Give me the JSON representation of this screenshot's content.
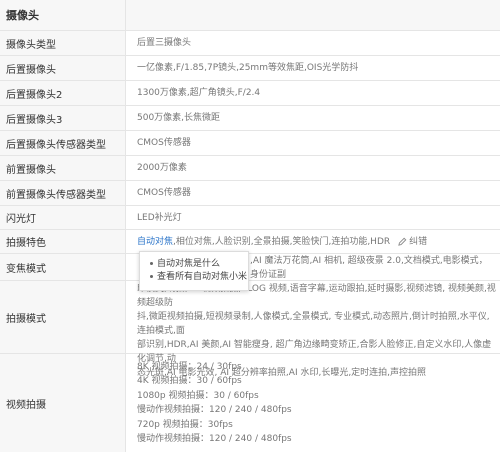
{
  "section": {
    "title": "摄像头"
  },
  "rows": [
    {
      "label": "摄像头类型",
      "value": "后置三摄像头"
    },
    {
      "label": "后置摄像头",
      "value": "一亿像素,F/1.85,7P镜头,25mm等效焦距,OIS光学防抖"
    },
    {
      "label": "后置摄像头2",
      "value": "1300万像素,超广角镜头,F/2.4"
    },
    {
      "label": "后置摄像头3",
      "value": "500万像素,长焦微距"
    },
    {
      "label": "后置摄像头传感器类型",
      "value": "CMOS传感器"
    },
    {
      "label": "前置摄像头",
      "value": "2000万像素"
    },
    {
      "label": "前置摄像头传感器类型",
      "value": "CMOS传感器"
    },
    {
      "label": "闪光灯",
      "value": "LED补光灯"
    }
  ],
  "features": {
    "label": "拍摄特色",
    "link": "自动对焦",
    "rest": ",相位对焦,人脸识别,全景拍摄,笑脸快门,连拍功能,HDR",
    "correct": "纠错"
  },
  "zoom": {
    "label": "变焦模式"
  },
  "shooting": {
    "label": "拍摄模式",
    "lines": [
      ",AI 魔法万花筒,AI 相机, 超级夜景 2.0,文档模式,电影模式，身份证副",
      "印模式,萌拍,4K 视频拍摄,VLOG 视频,语音字幕,运动跟拍,延时摄影,视频滤镜, 视频美颜,视频超级防",
      "抖,微距视频拍摄,短视频录制,人像模式,全景模式, 专业模式,动态照片,倒计时拍照,水平仪,连拍模式,面",
      "部识别,HDR,AI 美颜,AI 智能瘦身, 超广角边缘畸变矫正,合影人脸修正,自定义水印,人像虚化调节,动",
      "态光斑,AI 电影光效, AI 超分辨率拍照,AI 水印,长曝光,定时连拍,声控拍照"
    ]
  },
  "video": {
    "label": "视频拍摄",
    "lines": [
      "8K 视频拍摄：24 / 30fps",
      "4K 视频拍摄：30 / 60fps",
      "1080p 视频拍摄：30 / 60fps",
      "慢动作视频拍摄：120 / 240 / 480fps",
      "720p 视频拍摄：30fps",
      "慢动作视频拍摄：120 / 240 / 480fps"
    ]
  },
  "popup": {
    "items": [
      "自动对焦是什么",
      "查看所有自动对焦小米"
    ]
  }
}
